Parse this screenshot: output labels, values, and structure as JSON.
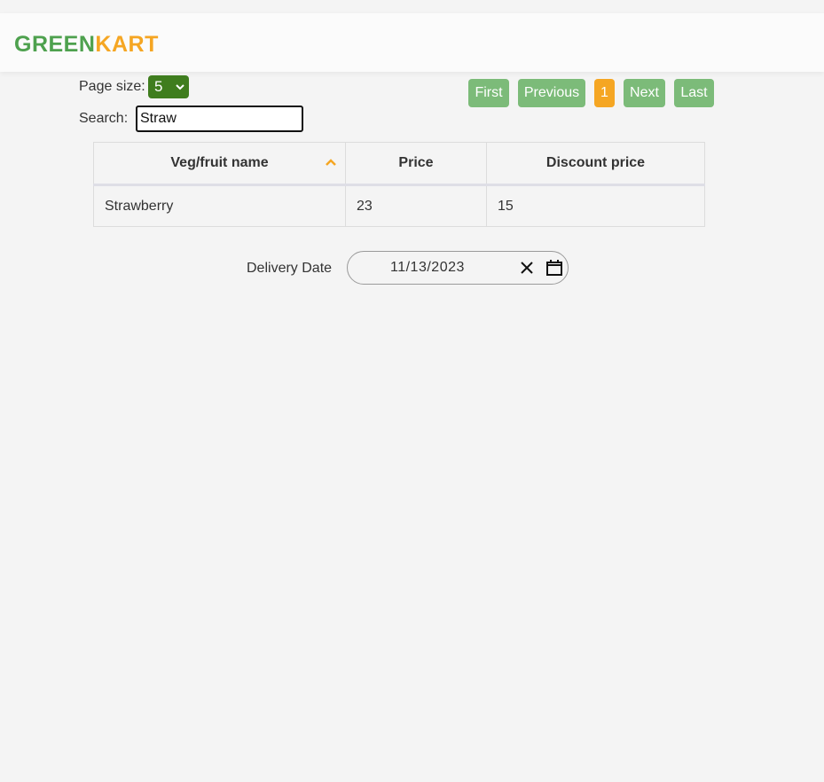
{
  "header": {
    "brand_part1": "GREEN",
    "brand_part2": "KART"
  },
  "controls": {
    "page_size_label": "Page size:",
    "page_size_value": "5",
    "search_label": "Search:",
    "search_value": "Straw"
  },
  "pagination": {
    "first": "First",
    "previous": "Previous",
    "current_page": "1",
    "next": "Next",
    "last": "Last"
  },
  "table": {
    "columns": [
      "Veg/fruit name",
      "Price",
      "Discount price"
    ],
    "sort": {
      "column": "Veg/fruit name",
      "direction": "ascending",
      "icon": "sort-up-icon",
      "color": "#f5a623"
    },
    "rows": [
      {
        "name": "Strawberry",
        "price": "23",
        "discount": "15"
      }
    ]
  },
  "delivery": {
    "label": "Delivery Date",
    "date_value": "11/13/2023",
    "icons": [
      "clear-icon",
      "calendar-icon"
    ]
  },
  "colors": {
    "brand_green": "#4ea14e",
    "brand_orange": "#f5a623",
    "button_green": "#7cbb79",
    "select_green": "#3f7d1e"
  }
}
